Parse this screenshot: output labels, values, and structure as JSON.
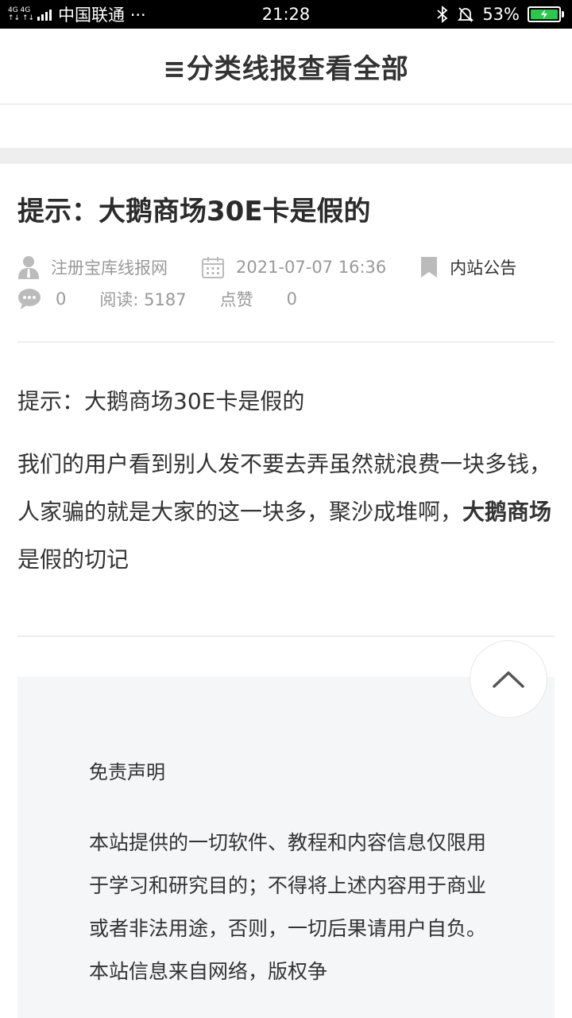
{
  "status_bar": {
    "network_top": "4G 4G",
    "network_bottom": "↑↓ ↑↓",
    "carrier": "中国联通 ···",
    "time": "21:28",
    "battery": "53%",
    "colors": {
      "battery_fill": "#29c94a"
    }
  },
  "header": {
    "title": "≡分类线报查看全部"
  },
  "article": {
    "title": "提示：大鹅商场30E卡是假的",
    "author": "注册宝库线报网",
    "date": "2021-07-07 16:36",
    "category": "内站公告",
    "comments": "0",
    "reads": "阅读: 5187",
    "likes_label": "点赞",
    "likes": "0",
    "lead": "提示：大鹅商场30E卡是假的",
    "body_text": "我们的用户看到别人发不要去弄虽然就浪费一块多钱，人家骗的就是大家的这一块多，聚沙成堆啊，",
    "body_bold": "大鹅商场",
    "body_tail": "是假的切记"
  },
  "disclaimer": {
    "title": "免责声明",
    "text": "本站提供的一切软件、教程和内容信息仅限用于学习和研究目的；不得将上述内容用于商业或者非法用途，否则，一切后果请用户自负。本站信息来自网络，版权争"
  },
  "icons": {
    "author": "user-icon",
    "date": "calendar-icon",
    "category": "bookmark-icon",
    "comments": "comment-icon",
    "back_to_top": "chevron-up-icon"
  }
}
